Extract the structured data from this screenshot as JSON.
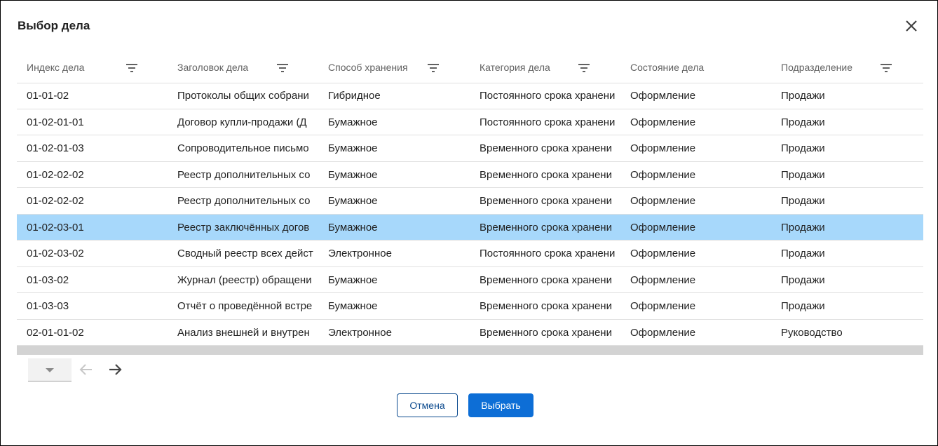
{
  "dialog": {
    "title": "Выбор дела",
    "columns": [
      {
        "label": "Индекс дела",
        "has_filter": true
      },
      {
        "label": "Заголовок дела",
        "has_filter": true
      },
      {
        "label": "Способ хранения",
        "has_filter": true
      },
      {
        "label": "Категория дела",
        "has_filter": true
      },
      {
        "label": "Состояние дела",
        "has_filter": false
      },
      {
        "label": "Подразделение",
        "has_filter": true
      }
    ],
    "rows": [
      {
        "index": "01-01-02",
        "title": "Протоколы общих собрани",
        "storage": "Гибридное",
        "category": "Постоянного срока хранени",
        "state": "Оформление",
        "department": "Продажи",
        "selected": false
      },
      {
        "index": "01-02-01-01",
        "title": "Договор купли-продажи (Д",
        "storage": "Бумажное",
        "category": "Постоянного срока хранени",
        "state": "Оформление",
        "department": "Продажи",
        "selected": false
      },
      {
        "index": "01-02-01-03",
        "title": "Сопроводительное письмо",
        "storage": "Бумажное",
        "category": "Временного срока хранени",
        "state": "Оформление",
        "department": "Продажи",
        "selected": false
      },
      {
        "index": "01-02-02-02",
        "title": "Реестр дополнительных со",
        "storage": "Бумажное",
        "category": "Временного срока хранени",
        "state": "Оформление",
        "department": "Продажи",
        "selected": false
      },
      {
        "index": "01-02-02-02",
        "title": "Реестр дополнительных со",
        "storage": "Бумажное",
        "category": "Временного срока хранени",
        "state": "Оформление",
        "department": "Продажи",
        "selected": false
      },
      {
        "index": "01-02-03-01",
        "title": "Реестр заключённых догов",
        "storage": "Бумажное",
        "category": "Временного срока хранени",
        "state": "Оформление",
        "department": "Продажи",
        "selected": true
      },
      {
        "index": "01-02-03-02",
        "title": "Сводный реестр всех дейст",
        "storage": "Электронное",
        "category": "Постоянного срока хранени",
        "state": "Оформление",
        "department": "Продажи",
        "selected": false
      },
      {
        "index": "01-03-02",
        "title": "Журнал (реестр) обращени",
        "storage": "Бумажное",
        "category": "Временного срока хранени",
        "state": "Оформление",
        "department": "Продажи",
        "selected": false
      },
      {
        "index": "01-03-03",
        "title": "Отчёт о проведённой встре",
        "storage": "Бумажное",
        "category": "Временного срока хранени",
        "state": "Оформление",
        "department": "Продажи",
        "selected": false
      },
      {
        "index": "02-01-01-02",
        "title": "Анализ внешней и внутрен",
        "storage": "Электронное",
        "category": "Временного срока хранени",
        "state": "Оформление",
        "department": "Руководство",
        "selected": false
      }
    ],
    "pager": {
      "page_size_value": "",
      "prev_enabled": false,
      "next_enabled": true
    },
    "buttons": {
      "cancel": "Отмена",
      "select": "Выбрать"
    },
    "colors": {
      "accent": "#0d6ed6",
      "selected_row": "#a7d8fb",
      "cancel_border": "#0b4a8e"
    },
    "icons": {
      "close": "close-icon",
      "filter": "filter-icon",
      "prev": "arrow-left-icon",
      "next": "arrow-right-icon",
      "dropdown": "triangle-down-icon"
    }
  }
}
